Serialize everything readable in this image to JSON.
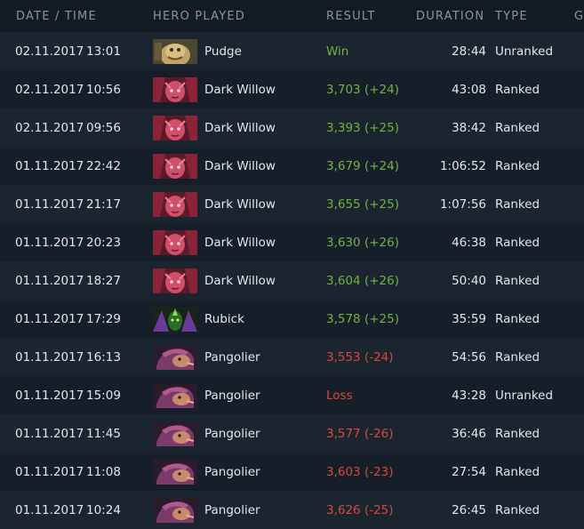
{
  "header": {
    "date_time": "DATE / TIME",
    "hero_played": "HERO PLAYED",
    "result": "RESULT",
    "duration": "DURATION",
    "type": "TYPE",
    "extra": "G"
  },
  "colors": {
    "win": "#74b144",
    "loss": "#d8483a"
  },
  "matches": [
    {
      "date": "02.11.2017",
      "time": "13:01",
      "hero": "Pudge",
      "hero_icon": "pudge-portrait-icon",
      "result": "Win",
      "outcome": "win",
      "duration": "28:44",
      "type": "Unranked"
    },
    {
      "date": "02.11.2017",
      "time": "10:56",
      "hero": "Dark Willow",
      "hero_icon": "dark-willow-portrait-icon",
      "result": "3,703 (+24)",
      "outcome": "win",
      "duration": "43:08",
      "type": "Ranked"
    },
    {
      "date": "02.11.2017",
      "time": "09:56",
      "hero": "Dark Willow",
      "hero_icon": "dark-willow-portrait-icon",
      "result": "3,393 (+25)",
      "outcome": "win",
      "duration": "38:42",
      "type": "Ranked"
    },
    {
      "date": "01.11.2017",
      "time": "22:42",
      "hero": "Dark Willow",
      "hero_icon": "dark-willow-portrait-icon",
      "result": "3,679 (+24)",
      "outcome": "win",
      "duration": "1:06:52",
      "type": "Ranked"
    },
    {
      "date": "01.11.2017",
      "time": "21:17",
      "hero": "Dark Willow",
      "hero_icon": "dark-willow-portrait-icon",
      "result": "3,655 (+25)",
      "outcome": "win",
      "duration": "1:07:56",
      "type": "Ranked"
    },
    {
      "date": "01.11.2017",
      "time": "20:23",
      "hero": "Dark Willow",
      "hero_icon": "dark-willow-portrait-icon",
      "result": "3,630 (+26)",
      "outcome": "win",
      "duration": "46:38",
      "type": "Ranked"
    },
    {
      "date": "01.11.2017",
      "time": "18:27",
      "hero": "Dark Willow",
      "hero_icon": "dark-willow-portrait-icon",
      "result": "3,604 (+26)",
      "outcome": "win",
      "duration": "50:40",
      "type": "Ranked"
    },
    {
      "date": "01.11.2017",
      "time": "17:29",
      "hero": "Rubick",
      "hero_icon": "rubick-portrait-icon",
      "result": "3,578 (+25)",
      "outcome": "win",
      "duration": "35:59",
      "type": "Ranked"
    },
    {
      "date": "01.11.2017",
      "time": "16:13",
      "hero": "Pangolier",
      "hero_icon": "pangolier-portrait-icon",
      "result": "3,553 (-24)",
      "outcome": "loss",
      "duration": "54:56",
      "type": "Ranked"
    },
    {
      "date": "01.11.2017",
      "time": "15:09",
      "hero": "Pangolier",
      "hero_icon": "pangolier-portrait-icon",
      "result": "Loss",
      "outcome": "loss",
      "duration": "43:28",
      "type": "Unranked"
    },
    {
      "date": "01.11.2017",
      "time": "11:45",
      "hero": "Pangolier",
      "hero_icon": "pangolier-portrait-icon",
      "result": "3,577 (-26)",
      "outcome": "loss",
      "duration": "36:46",
      "type": "Ranked"
    },
    {
      "date": "01.11.2017",
      "time": "11:08",
      "hero": "Pangolier",
      "hero_icon": "pangolier-portrait-icon",
      "result": "3,603 (-23)",
      "outcome": "loss",
      "duration": "27:54",
      "type": "Ranked"
    },
    {
      "date": "01.11.2017",
      "time": "10:24",
      "hero": "Pangolier",
      "hero_icon": "pangolier-portrait-icon",
      "result": "3,626 (-25)",
      "outcome": "loss",
      "duration": "26:45",
      "type": "Ranked"
    }
  ]
}
